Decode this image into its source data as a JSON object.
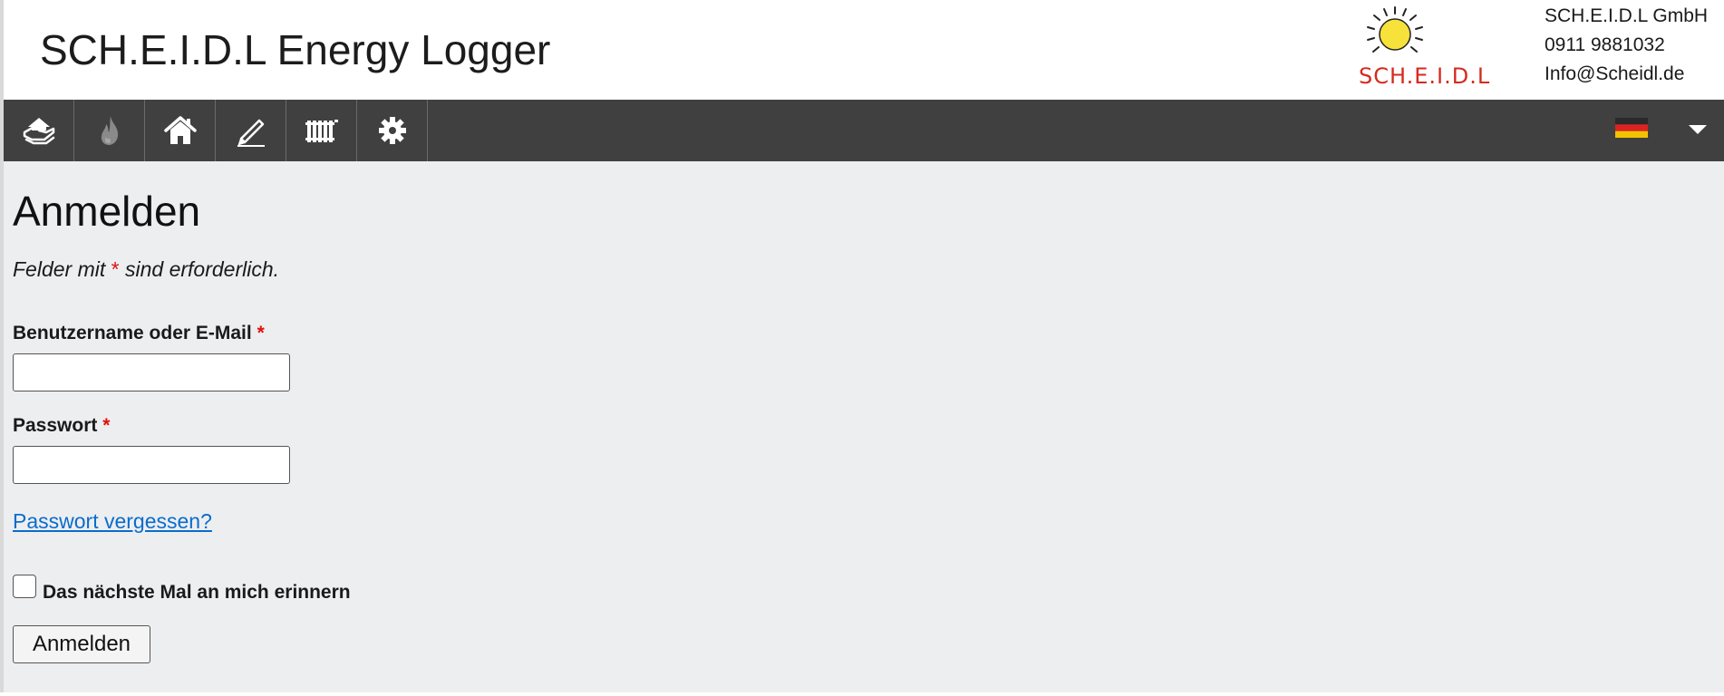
{
  "header": {
    "title": "SCH.E.I.D.L Energy Logger",
    "logo_text": "SCH.E.I.D.L",
    "contact": {
      "company": "SCH.E.I.D.L GmbH",
      "phone": "0911 9881032",
      "email": "Info@Scheidl.de"
    }
  },
  "nav": {
    "items": [
      {
        "icon": "hand-house-icon"
      },
      {
        "icon": "flame-icon"
      },
      {
        "icon": "home-icon"
      },
      {
        "icon": "pencil-icon"
      },
      {
        "icon": "radiator-icon"
      },
      {
        "icon": "gear-icon"
      }
    ],
    "language_flag": "flag-germany-icon",
    "language_dropdown": "chevron-down-icon"
  },
  "login": {
    "title": "Anmelden",
    "required_note_prefix": "Felder mit ",
    "required_marker": "*",
    "required_note_suffix": " sind erforderlich.",
    "username_label": "Benutzername oder E-Mail",
    "username_value": "",
    "password_label": "Passwort",
    "password_value": "",
    "forgot_link": "Passwort vergessen?",
    "remember_label": "Das nächste Mal an mich erinnern",
    "remember_checked": false,
    "submit_label": "Anmelden"
  },
  "colors": {
    "navbar": "#404040",
    "page_background": "#edeef0",
    "required": "#e01010",
    "link": "#0a6ccc",
    "logo_text": "#d42a1e",
    "sun": "#f7e13b"
  }
}
